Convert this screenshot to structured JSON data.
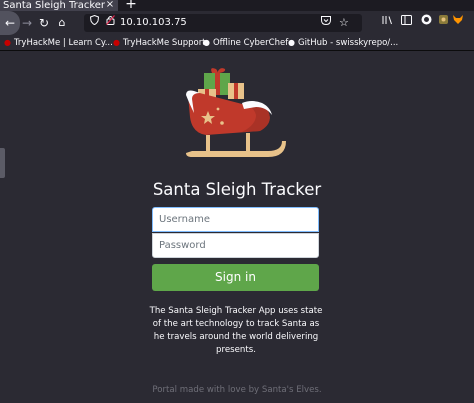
{
  "browser": {
    "tab_title": "Santa Sleigh Tracker",
    "tab_close": "×",
    "new_tab": "+",
    "nav": {
      "back": "←",
      "forward": "→",
      "reload": "↻",
      "home": "⌂"
    },
    "url": "10.10.103.75",
    "bookmarks": [
      {
        "label": "TryHackMe | Learn Cy...",
        "icon": "tryhackme-icon"
      },
      {
        "label": "TryHackMe Support",
        "icon": "tryhackme-icon"
      },
      {
        "label": "Offline CyberChef",
        "icon": "cyberchef-icon"
      },
      {
        "label": "GitHub - swisskyrepo/...",
        "icon": "github-icon"
      }
    ]
  },
  "page": {
    "title": "Santa Sleigh Tracker",
    "username_placeholder": "Username",
    "password_placeholder": "Password",
    "signin_label": "Sign in",
    "description": "The Santa Sleigh Tracker App uses state of the art technology to track Santa as he travels around the world delivering presents.",
    "footer": "Portal made with love by Santa's Elves."
  },
  "colors": {
    "background": "#2b2a33",
    "signin_button": "#5fa64a",
    "sleigh_red": "#c0392b",
    "runner_gold": "#e8c28a"
  }
}
